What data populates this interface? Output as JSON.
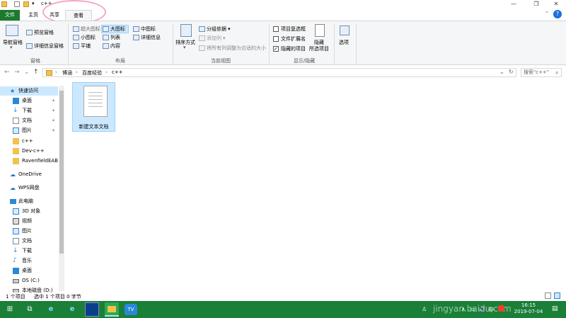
{
  "window": {
    "title": "c++",
    "minimize_glyph": "—",
    "maximize_glyph": "❐",
    "close_glyph": "✕",
    "qat_dropdown_glyph": "▾"
  },
  "tabs": {
    "file": "文件",
    "home": "主页",
    "share": "共享",
    "view": "查看",
    "help_glyph": "?",
    "collapse_glyph": "⌃"
  },
  "ribbon": {
    "panes": {
      "nav_pane": "导航窗格",
      "nav_pane_arrow": "▾",
      "preview_pane": "预览窗格",
      "details_pane": "详细信息窗格",
      "group_label": "窗格"
    },
    "layout": {
      "extra_large": "超大图标",
      "large": "大图标",
      "medium": "中图标",
      "small": "小图标",
      "list": "列表",
      "details": "详细信息",
      "tiles": "平铺",
      "content": "内容",
      "group_label": "布局"
    },
    "current_view": {
      "sort_by": "排序方式",
      "sort_arrow": "▾",
      "group_by": "分组依据",
      "add_columns": "添加列",
      "size_all_columns": "将所有列调整为合适的大小",
      "group_label": "当前视图"
    },
    "show_hide": {
      "item_checkboxes": "项目复选框",
      "item_checkboxes_checked": false,
      "file_extensions": "文件扩展名",
      "file_extensions_checked": false,
      "hidden_items": "隐藏的项目",
      "hidden_items_checked": true,
      "hide_selected_line1": "隐藏",
      "hide_selected_line2": "所选项目",
      "group_label": "显示/隐藏"
    },
    "options": "选项"
  },
  "address": {
    "back": "←",
    "forward": "→",
    "recent": "⌄",
    "up": "↑",
    "breadcrumbs": [
      "博涵",
      "百度经验",
      "c++"
    ],
    "separator": "›",
    "dropdown": "⌄",
    "refresh": "↻",
    "search_placeholder": "搜索\"c++\""
  },
  "sidebar": {
    "quick_access": "快速访问",
    "items": [
      {
        "label": "桌面",
        "icon": "desktop-icon",
        "pinned": true
      },
      {
        "label": "下载",
        "icon": "download-icon",
        "pinned": true
      },
      {
        "label": "文档",
        "icon": "documents-icon",
        "pinned": true
      },
      {
        "label": "图片",
        "icon": "pictures-icon",
        "pinned": true
      },
      {
        "label": "c++",
        "icon": "folder-icon",
        "pinned": false
      },
      {
        "label": "Dev-c++",
        "icon": "folder-icon",
        "pinned": false
      },
      {
        "label": "RavenfieldEABe",
        "icon": "folder-icon",
        "pinned": false
      }
    ],
    "pin_glyph": "📌",
    "onedrive": "OneDrive",
    "wps": "WPS网盘",
    "this_pc": "此电脑",
    "pc_items": [
      {
        "label": "3D 对象",
        "icon": "3d-objects-icon"
      },
      {
        "label": "视频",
        "icon": "videos-icon"
      },
      {
        "label": "图片",
        "icon": "pictures-icon"
      },
      {
        "label": "文档",
        "icon": "documents-icon"
      },
      {
        "label": "下载",
        "icon": "download-icon"
      },
      {
        "label": "音乐",
        "icon": "music-icon"
      },
      {
        "label": "桌面",
        "icon": "desktop-icon"
      },
      {
        "label": "OS (C:)",
        "icon": "drive-icon"
      },
      {
        "label": "本地磁盘 (D:)",
        "icon": "drive-icon"
      }
    ]
  },
  "files": [
    {
      "name": "新建文本文档",
      "icon": "text-file-icon"
    }
  ],
  "status": {
    "count": "1 个项目",
    "selected": "选中 1 个项目  0 字节"
  },
  "taskbar": {
    "start_glyph": "⊞",
    "taskview_glyph": "⧉",
    "tray_glyphs": [
      "∧",
      "▭",
      "🔊",
      "中"
    ],
    "time": "16:15",
    "date": "2019-07-04",
    "notification_glyph": "▤",
    "watermark": "jingyan.baidu.com"
  },
  "colors": {
    "accent": "#1b7a2e",
    "selection": "#cce8ff",
    "taskbar": "#1a7f37",
    "highlight": "#f4a6c8"
  }
}
